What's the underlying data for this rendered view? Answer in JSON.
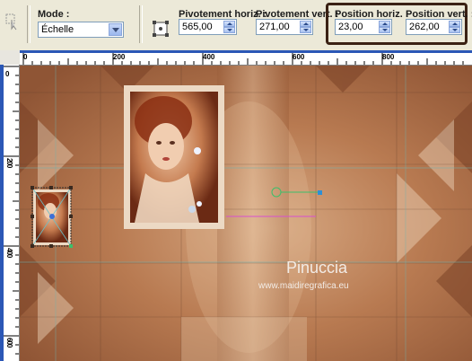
{
  "toolbar": {
    "mode_label": "Mode :",
    "mode_value": "Échelle",
    "pivot_h_label": "Pivotement horiz. :",
    "pivot_h_value": "565,00",
    "pivot_v_label": "Pivotement vert. :",
    "pivot_v_value": "271,00",
    "pos_h_label": "Position horiz. :",
    "pos_h_value": "23,00",
    "pos_v_label": "Position vert. :",
    "pos_v_value": "262,00"
  },
  "ruler": {
    "top_ticks": [
      "0",
      "200",
      "400",
      "600",
      "800"
    ],
    "left_ticks": [
      "0",
      "200",
      "400",
      "600"
    ]
  },
  "watermark": {
    "name": "Pinuccia",
    "site": "www.maidiregrafica.eu"
  },
  "colors": {
    "highlight_frame": "#3a2114",
    "canvas_base": "#b8784e",
    "handle_green": "#3dbf6a"
  }
}
